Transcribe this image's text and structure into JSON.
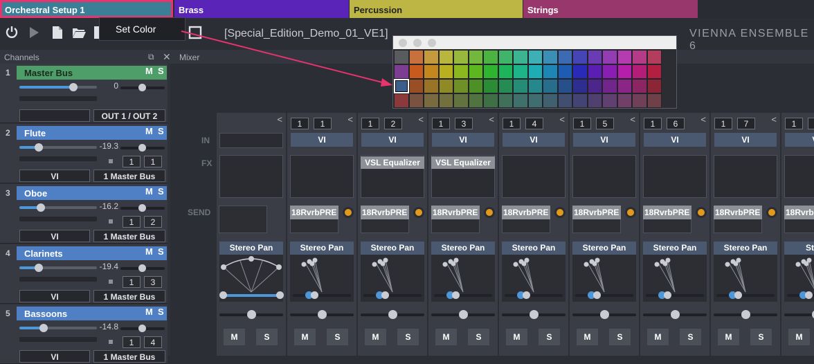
{
  "tabs": [
    {
      "label": "Orchestral Setup 1",
      "color": "#3b7f97"
    },
    {
      "label": "Brass",
      "color": "#5a24b9"
    },
    {
      "label": "Percussion",
      "color": "#bdb644"
    },
    {
      "label": "Strings",
      "color": "#97376c"
    }
  ],
  "toolbar": {
    "icons": [
      "power-icon",
      "play-icon",
      "new-file-icon",
      "open-folder-icon",
      "save-icon",
      "window-icon"
    ],
    "project_name": "[Special_Edition_Demo_01_VE1]",
    "brand": "VIENNA ENSEMBLE 6"
  },
  "context_menu": {
    "item": "Set Color"
  },
  "panels": {
    "channels": "Channels",
    "mixer": "Mixer"
  },
  "channels": [
    {
      "num": "1",
      "name": "Master Bus",
      "m": "M",
      "s": "S",
      "color": "#4d9e69",
      "db": "0",
      "level": 0.7,
      "io": [
        "OUT 1 / OUT 2"
      ],
      "inputs": []
    },
    {
      "num": "2",
      "name": "Flute",
      "m": "M",
      "s": "S",
      "color": "#4f7fc4",
      "db": "-19.3",
      "level": 0.25,
      "io": [
        "VI",
        "1 Master Bus"
      ],
      "inputs": [
        "1",
        "1"
      ]
    },
    {
      "num": "3",
      "name": "Oboe",
      "m": "M",
      "s": "S",
      "color": "#4f7fc4",
      "db": "-16.2",
      "level": 0.28,
      "io": [
        "VI",
        "1 Master Bus"
      ],
      "inputs": [
        "1",
        "2"
      ]
    },
    {
      "num": "4",
      "name": "Clarinets",
      "m": "M",
      "s": "S",
      "color": "#4f7fc4",
      "db": "-19.4",
      "level": 0.25,
      "io": [
        "VI",
        "1 Master Bus"
      ],
      "inputs": [
        "1",
        "3"
      ]
    },
    {
      "num": "5",
      "name": "Bassoons",
      "m": "M",
      "s": "S",
      "color": "#4f7fc4",
      "db": "-14.8",
      "level": 0.31,
      "io": [
        "VI",
        "1 Master Bus"
      ],
      "inputs": [
        "1",
        "4"
      ]
    }
  ],
  "mixer": {
    "row_labels": {
      "in": "IN",
      "fx": "FX",
      "send": "SEND"
    },
    "strips": [
      {
        "inputs": [
          "1",
          "1"
        ],
        "vi": "VI",
        "fx": "",
        "send": "18RvrbPRE",
        "pan": "Stereo Pan",
        "m": "M",
        "s": "S"
      },
      {
        "inputs": [
          "1",
          "2"
        ],
        "vi": "VI",
        "fx": "VSL Equalizer",
        "send": "18RvrbPRE",
        "pan": "Stereo Pan",
        "m": "M",
        "s": "S"
      },
      {
        "inputs": [
          "1",
          "3"
        ],
        "vi": "VI",
        "fx": "VSL Equalizer",
        "send": "18RvrbPRE",
        "pan": "Stereo Pan",
        "m": "M",
        "s": "S"
      },
      {
        "inputs": [
          "1",
          "4"
        ],
        "vi": "VI",
        "fx": "",
        "send": "18RvrbPRE",
        "pan": "Stereo Pan",
        "m": "M",
        "s": "S"
      },
      {
        "inputs": [
          "1",
          "5"
        ],
        "vi": "VI",
        "fx": "",
        "send": "18RvrbPRE",
        "pan": "Stereo Pan",
        "m": "M",
        "s": "S"
      },
      {
        "inputs": [
          "1",
          "6"
        ],
        "vi": "VI",
        "fx": "",
        "send": "18RvrbPRE",
        "pan": "Stereo Pan",
        "m": "M",
        "s": "S"
      },
      {
        "inputs": [
          "1",
          "7"
        ],
        "vi": "VI",
        "fx": "",
        "send": "18RvrbPRE",
        "pan": "Stereo Pan",
        "m": "M",
        "s": "S"
      },
      {
        "inputs": [
          "1",
          ""
        ],
        "vi": "VI",
        "fx": "",
        "send": "18RvrbPRE",
        "pan": "Stere",
        "m": "M",
        "s": "S"
      }
    ],
    "master_strip": {
      "pan": "Stereo Pan",
      "m": "M",
      "s": "S"
    }
  },
  "color_picker": {
    "selected": "#3b5f8a",
    "rows": [
      [
        "#5a5b5e",
        "#c9703c",
        "#c49a3c",
        "#b8b63c",
        "#97b83c",
        "#73b83c",
        "#4bb441",
        "#3fb46a",
        "#3cb491",
        "#3cb0b4",
        "#3c8fb4",
        "#3c6bb4",
        "#4545b8",
        "#6a3cb4",
        "#943cb4",
        "#b43cb0",
        "#b43c87",
        "#b43c5c"
      ],
      [
        "#7c3d92",
        "#c95a1e",
        "#c4871e",
        "#b8b01e",
        "#8ab81e",
        "#5cb81e",
        "#2fb42f",
        "#1eb45a",
        "#1eb48a",
        "#1eadb4",
        "#1e86b4",
        "#1e5cb4",
        "#2a2ab8",
        "#5a1eb4",
        "#8a1eb4",
        "#b41eaa",
        "#b41e78",
        "#b41e41"
      ],
      [
        "#3b5f8a",
        "#9a4e26",
        "#9a7426",
        "#908a26",
        "#6f9026",
        "#4d9026",
        "#2a8c34",
        "#268c54",
        "#268c76",
        "#26888c",
        "#266e8c",
        "#264f8c",
        "#2e2e90",
        "#4d268c",
        "#72268c",
        "#8c2686",
        "#8c2662",
        "#8c2636"
      ],
      [
        "#8a3a3a",
        "#7a5240",
        "#7a6a40",
        "#737040",
        "#627340",
        "#507340",
        "#3f7045",
        "#40705a",
        "#40706a",
        "#406e70",
        "#406070",
        "#404f70",
        "#444474",
        "#504070",
        "#604070",
        "#704068",
        "#704058",
        "#704048"
      ]
    ]
  }
}
